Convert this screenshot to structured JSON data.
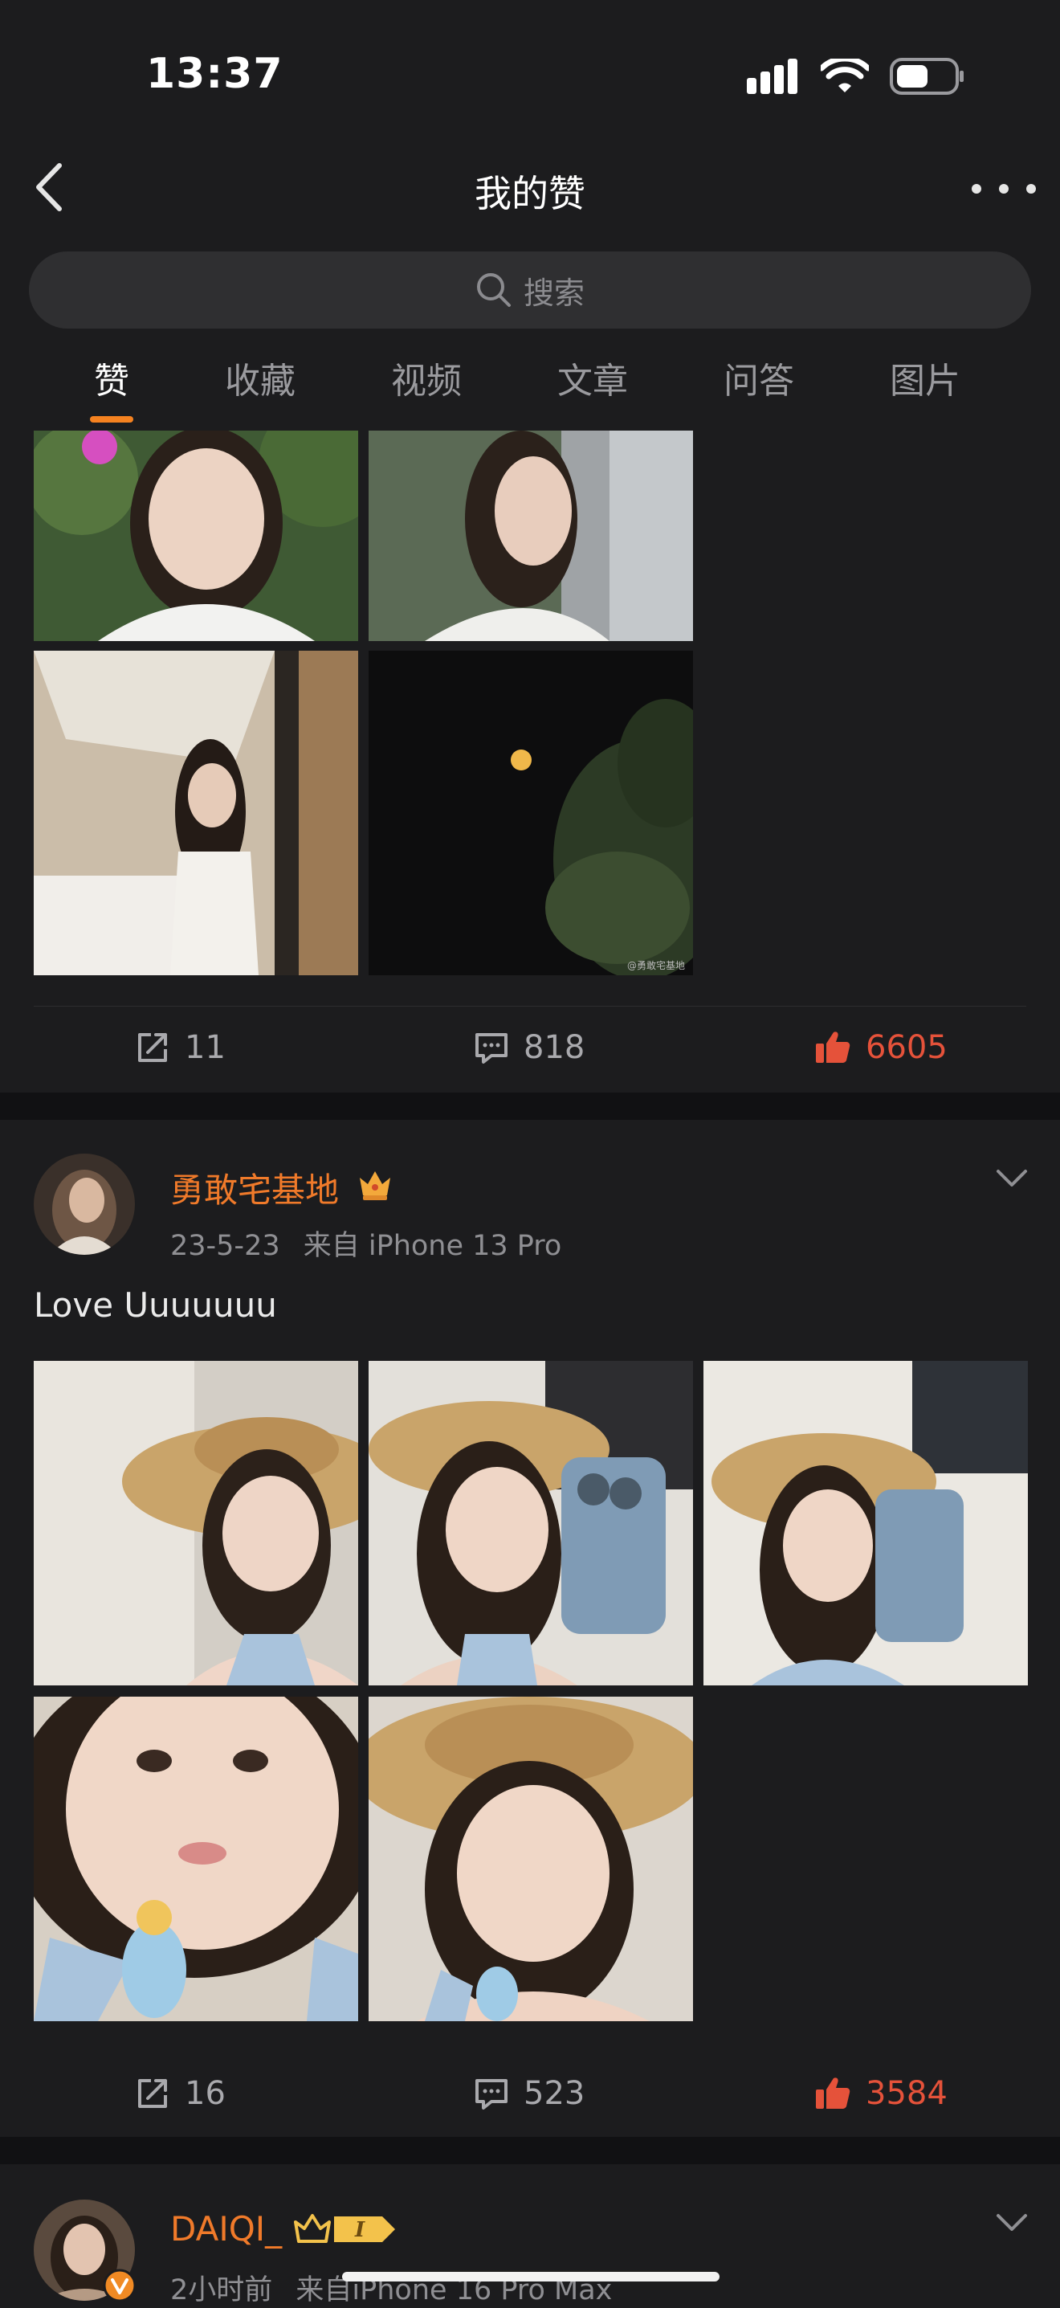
{
  "status": {
    "time": "13:37"
  },
  "nav": {
    "title": "我的赞"
  },
  "search": {
    "placeholder": "搜索"
  },
  "tabs": [
    {
      "label": "赞",
      "active": true
    },
    {
      "label": "收藏"
    },
    {
      "label": "视频"
    },
    {
      "label": "文章"
    },
    {
      "label": "问答"
    },
    {
      "label": "图片"
    }
  ],
  "post1": {
    "watermark": "@勇敢宅基地",
    "actions": {
      "reposts": "11",
      "comments": "818",
      "likes": "6605"
    }
  },
  "post2": {
    "username": "勇敢宅基地",
    "time": "23-5-23",
    "source": "来自 iPhone 13 Pro",
    "text": "Love Uuuuuuu",
    "actions": {
      "reposts": "16",
      "comments": "523",
      "likes": "3584"
    }
  },
  "post3": {
    "username": "DAIQI_",
    "badge": "I",
    "time": "2小时前",
    "source": "来自iPhone 16 Pro Max"
  },
  "colors": {
    "accent": "#f58220",
    "like": "#e5523a",
    "username": "#f07a2a",
    "background": "#1c1c1e"
  }
}
